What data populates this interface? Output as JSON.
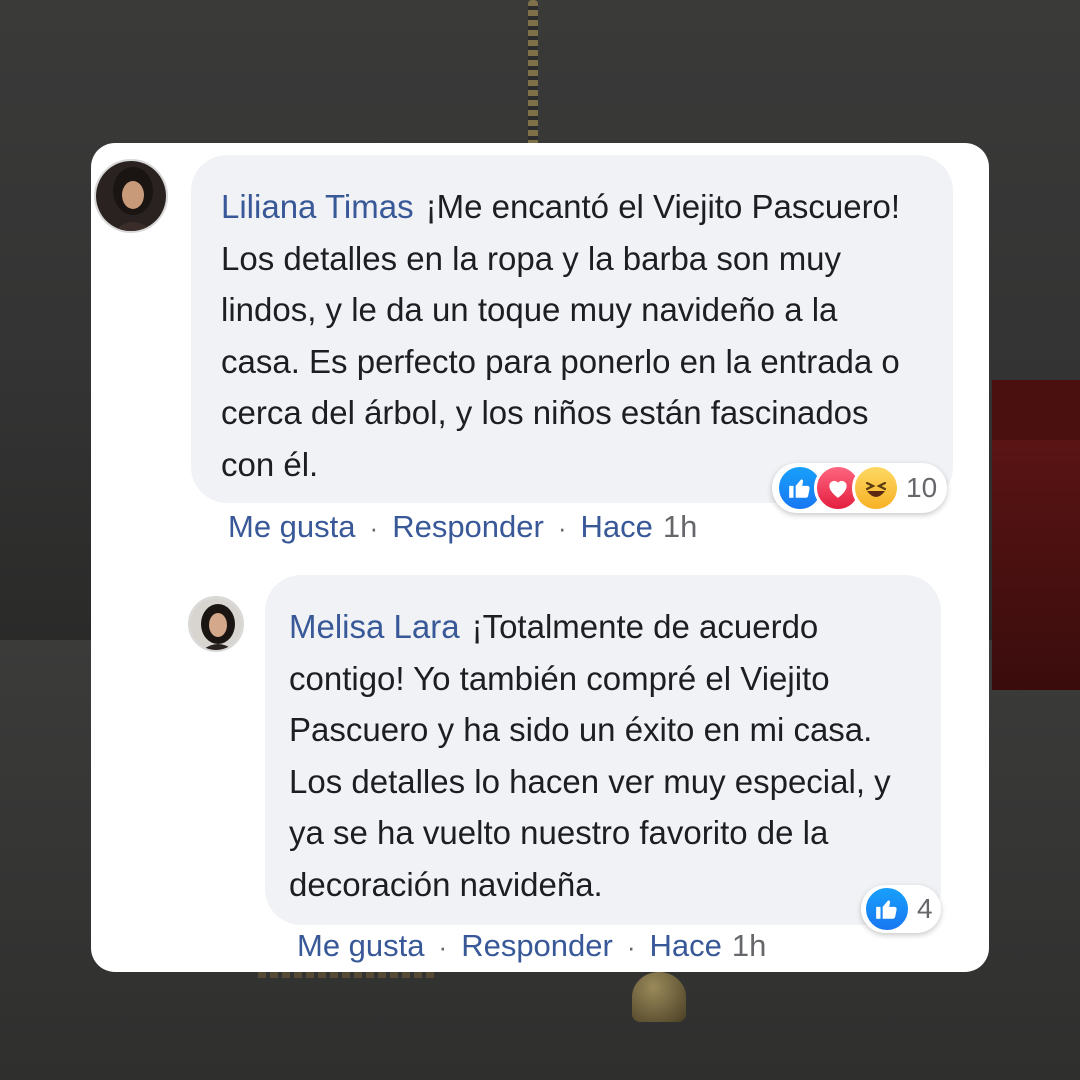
{
  "comments": [
    {
      "author": "Liliana Timas",
      "text": "¡Me encantó el Viejito Pascuero! Los detalles en la ropa y la barba son muy lindos, y le da un toque muy navideño a la casa. Es perfecto para ponerlo en la entrada o cerca del árbol, y los niños están fascinados con él.",
      "reaction_count": "10",
      "reactions": [
        "like-icon",
        "love-icon",
        "haha-icon"
      ],
      "actions": {
        "like": "Me gusta",
        "reply": "Responder",
        "time_label": "Hace",
        "time_value": "1h"
      }
    },
    {
      "author": "Melisa Lara",
      "text": "¡Totalmente de acuerdo contigo! Yo también compré el Viejito Pascuero y ha sido un éxito en mi casa. Los detalles lo hacen ver muy especial, y ya se ha vuelto nuestro favorito de la decoración navideña.",
      "reaction_count": "4",
      "reactions": [
        "like-icon"
      ],
      "actions": {
        "like": "Me gusta",
        "reply": "Responder",
        "time_label": "Hace",
        "time_value": "1h"
      }
    }
  ],
  "separator": "·",
  "colors": {
    "link": "#385898",
    "bubble": "#f0f2f5",
    "text": "#1c1e21",
    "meta": "#65676b"
  }
}
